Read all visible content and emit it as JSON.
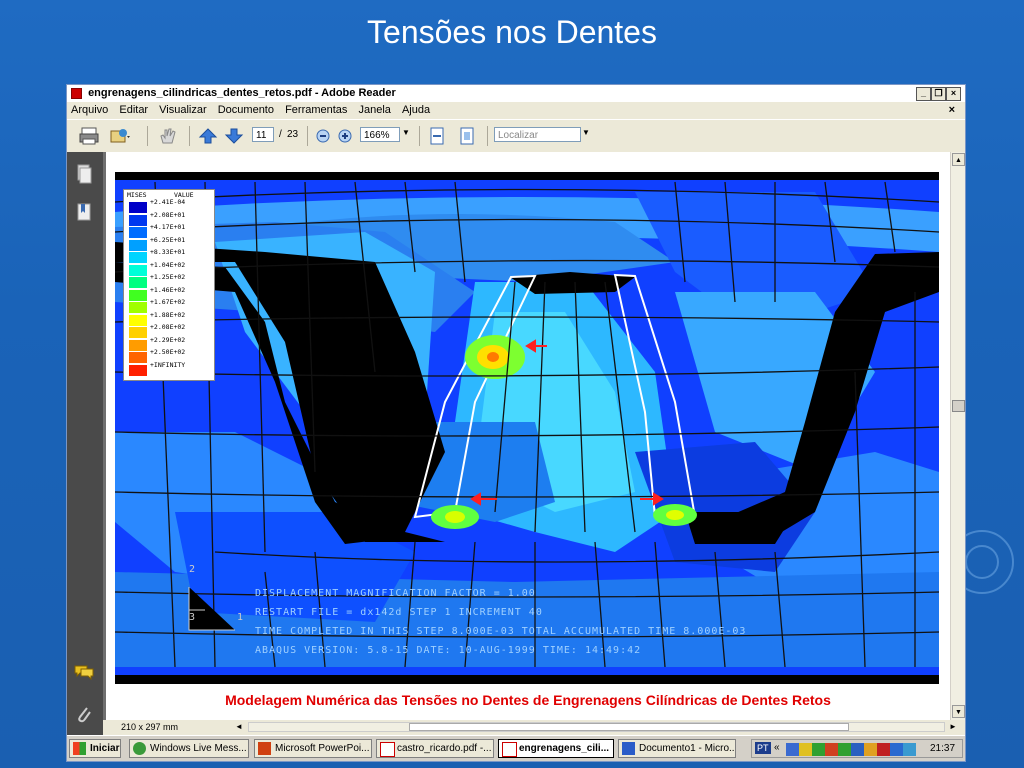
{
  "slide": {
    "title": "Tensões nos Dentes"
  },
  "window": {
    "title": "engrenagens_cilindricas_dentes_retos.pdf - Adobe Reader",
    "minimize": "_",
    "restore": "❐",
    "close": "×"
  },
  "menu": {
    "items": [
      "Arquivo",
      "Editar",
      "Visualizar",
      "Documento",
      "Ferramentas",
      "Janela",
      "Ajuda"
    ],
    "close": "×"
  },
  "toolbar": {
    "page_current": "11",
    "page_sep": "/",
    "page_total": "23",
    "zoom": "166%",
    "search_placeholder": "Localizar"
  },
  "figure": {
    "legend": {
      "header_left": "MISES",
      "header_right": "VALUE",
      "values": [
        "+2.41E-04",
        "+2.08E+01",
        "+4.17E+01",
        "+6.25E+01",
        "+8.33E+01",
        "+1.04E+02",
        "+1.25E+02",
        "+1.46E+02",
        "+1.67E+02",
        "+1.88E+02",
        "+2.08E+02",
        "+2.29E+02",
        "+2.50E+02",
        "+INFINITY"
      ],
      "colors": [
        "#0000c8",
        "#0038f0",
        "#006cff",
        "#00a0ff",
        "#00d4ff",
        "#00ffd8",
        "#00ff80",
        "#40ff20",
        "#a0ff00",
        "#ffff00",
        "#ffd000",
        "#ff9c00",
        "#ff6400",
        "#ff2000"
      ]
    },
    "axis_labels": {
      "y": "2",
      "x": "1",
      "z": "3"
    },
    "info_lines": [
      "DISPLACEMENT MAGNIFICATION FACTOR =    1.00",
      "RESTART FILE = dx142d   STEP 1  INCREMENT 40",
      "TIME COMPLETED IN THIS STEP    8.000E-03 TOTAL ACCUMULATED TIME    8.000E-03",
      "ABAQUS VERSION: 5.8-15   DATE: 10-AUG-1999   TIME: 14:49:42"
    ]
  },
  "caption": "Modelagem Numérica das Tensões no Dentes de Engrenagens Cilíndricas de Dentes Retos",
  "status": {
    "page_size": "210 x 297 mm"
  },
  "taskbar": {
    "start": "Iniciar",
    "tasks": [
      "Windows Live Mess...",
      "Microsoft PowerPoi...",
      "castro_ricardo.pdf -...",
      "engrenagens_cili...",
      "Documento1 - Micro..."
    ],
    "lang": "PT",
    "clock": "21:37"
  }
}
